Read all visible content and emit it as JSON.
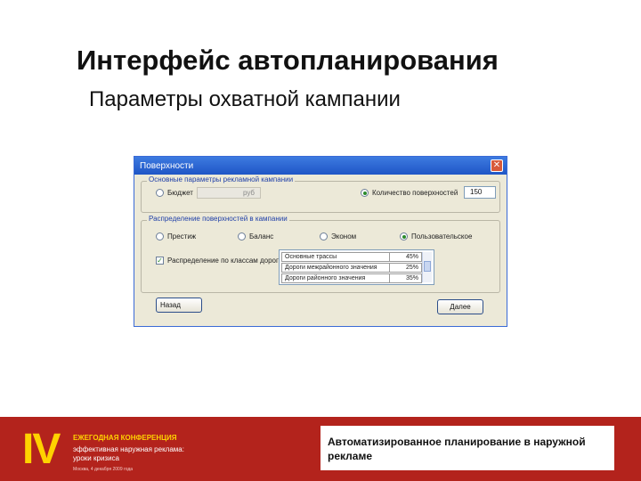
{
  "slide": {
    "title": "Интерфейс автопланирования",
    "subtitle": "Параметры охватной кампании"
  },
  "window": {
    "title": "Поверхности",
    "close_glyph": "✕"
  },
  "main_params": {
    "group_label": "Основные параметры рекламной кампании",
    "budget": {
      "label": "Бюджет",
      "unit": "руб",
      "selected": false
    },
    "surface_count": {
      "label": "Количество поверхностей",
      "value": "150",
      "selected": true
    }
  },
  "distribution": {
    "group_label": "Распределение поверхностей в кампании",
    "options": [
      {
        "label": "Престиж",
        "selected": false
      },
      {
        "label": "Баланс",
        "selected": false
      },
      {
        "label": "Эконом",
        "selected": false
      },
      {
        "label": "Пользовательское",
        "selected": true
      }
    ],
    "road_class_checkbox": {
      "label": "Распределение по классам дорог",
      "checked": true,
      "glyph": "✓"
    },
    "road_classes": [
      {
        "name": "Основные трассы",
        "percent": "45%"
      },
      {
        "name": "Дороги межрайонного значения",
        "percent": "25%"
      },
      {
        "name": "Дороги районного значения",
        "percent": "35%"
      }
    ]
  },
  "buttons": {
    "back": "Назад",
    "next": "Далее"
  },
  "footer": {
    "roman": "IV",
    "line1": "ЕЖЕГОДНАЯ КОНФЕРЕНЦИЯ",
    "line2": "эффективная наружная реклама:",
    "line3": "уроки кризиса",
    "line4": "Москва, 4 декабря 2009 года",
    "caption": "Автоматизированное планирование в наружной рекламе"
  },
  "colors": {
    "footer_red": "#b3231c",
    "footer_yellow": "#ffd200",
    "titlebar_blue": "#1f55c6",
    "dialog_bg": "#ece9d8"
  }
}
